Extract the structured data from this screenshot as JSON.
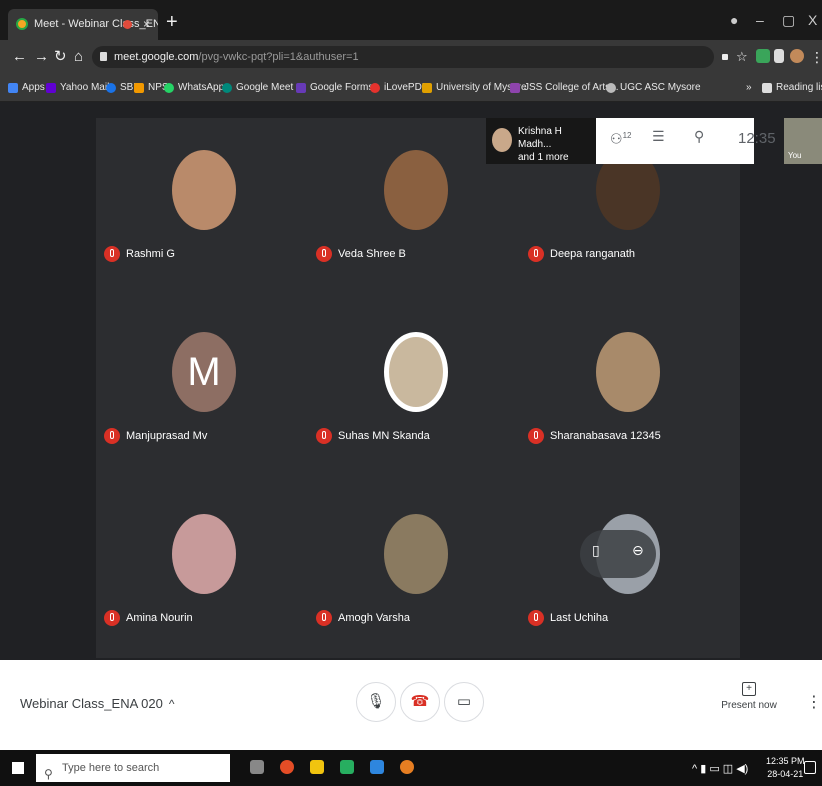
{
  "browser": {
    "tab_title": "Meet - Webinar Class_ENA (",
    "tab_close": "×",
    "new_tab": "+",
    "window_controls": {
      "minimize": "–",
      "maximize": "▢",
      "close": "X"
    },
    "url_host": "meet.google.com",
    "url_path": "/pvg-vwkc-pqt?pli=1&authuser=1",
    "bookmarks": [
      {
        "label": "Apps",
        "color": "#4285f4"
      },
      {
        "label": "Yahoo Mail",
        "color": "#6001d2"
      },
      {
        "label": "SBI",
        "color": "#1a73e8"
      },
      {
        "label": "NPS",
        "color": "#f29900"
      },
      {
        "label": "WhatsApp",
        "color": "#25d366"
      },
      {
        "label": "Google Meet",
        "color": "#00897b"
      },
      {
        "label": "Google Forms",
        "color": "#673ab7"
      },
      {
        "label": "iLovePDF",
        "color": "#e5322d"
      },
      {
        "label": "University of Mysore",
        "color": "#e0a000"
      },
      {
        "label": "JSS College of Arts...",
        "color": "#8e44ad"
      },
      {
        "label": "UGC ASC Mysore",
        "color": "#bbbbbb"
      }
    ],
    "bookmarks_overflow": "»",
    "reading_list": "Reading list"
  },
  "meet": {
    "presenter": {
      "name": "Krishna H Madh...",
      "sub": "and 1 more"
    },
    "participants_count": "12",
    "clock": "12:35",
    "self_label": "You",
    "participants": [
      {
        "name": "Rashmi G",
        "avatar": "photo",
        "tone": "#b98a6a"
      },
      {
        "name": "Veda Shree B",
        "avatar": "photo",
        "tone": "#8a6040"
      },
      {
        "name": "Deepa ranganath",
        "avatar": "photo",
        "tone": "#4a3526"
      },
      {
        "name": "Manjuprasad Mv",
        "avatar": "initial",
        "initial": "M",
        "tone": "#8d6e63"
      },
      {
        "name": "Suhas MN Skanda",
        "avatar": "photo-ring",
        "tone": "#c9b89e"
      },
      {
        "name": "Sharanabasava 12345",
        "avatar": "photo",
        "tone": "#a88a6a"
      },
      {
        "name": "Amina Nourin",
        "avatar": "photo",
        "tone": "#c79a9a"
      },
      {
        "name": "Amogh Varsha",
        "avatar": "photo",
        "tone": "#8a7a60"
      },
      {
        "name": "Last Uchiha",
        "avatar": "photo",
        "tone": "#9aa0a8"
      }
    ],
    "meeting_name": "Webinar Class_ENA 020",
    "meeting_chevron": "^",
    "present_now": "Present now",
    "more": "⋮"
  },
  "taskbar": {
    "search_placeholder": "Type here to search",
    "time": "12:35 PM",
    "date": "28-04-21"
  }
}
